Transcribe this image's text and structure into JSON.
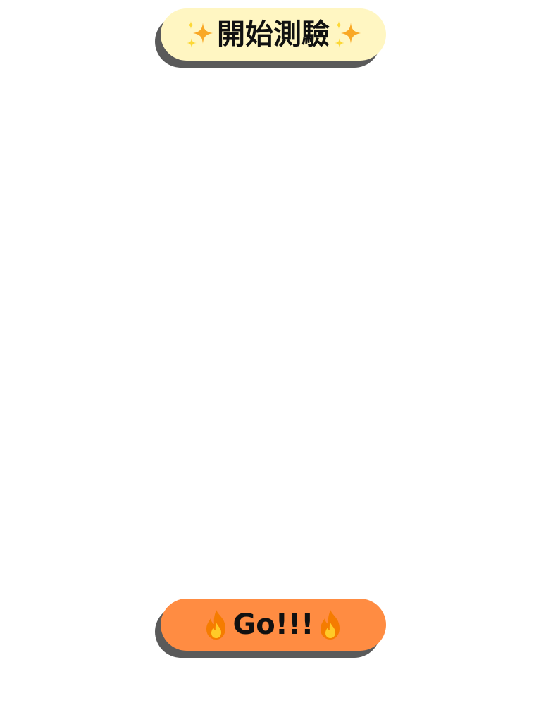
{
  "start_button": {
    "label": "開始測驗",
    "left_icon": "sparkles-icon",
    "right_icon": "sparkles-icon",
    "background": "#fff6c2",
    "shadow": "#5a5a5a"
  },
  "go_button": {
    "label": "Go!!!",
    "left_icon": "fire-icon",
    "right_icon": "fire-icon",
    "background": "#ff8c42",
    "shadow": "#5a5a5a"
  },
  "colors": {
    "page_background": "#ffffff",
    "sparkle_main": "#f9a825",
    "sparkle_accent": "#fdd835",
    "fire_outer": "#f57c00",
    "fire_inner": "#ffca28",
    "text": "#111111"
  }
}
